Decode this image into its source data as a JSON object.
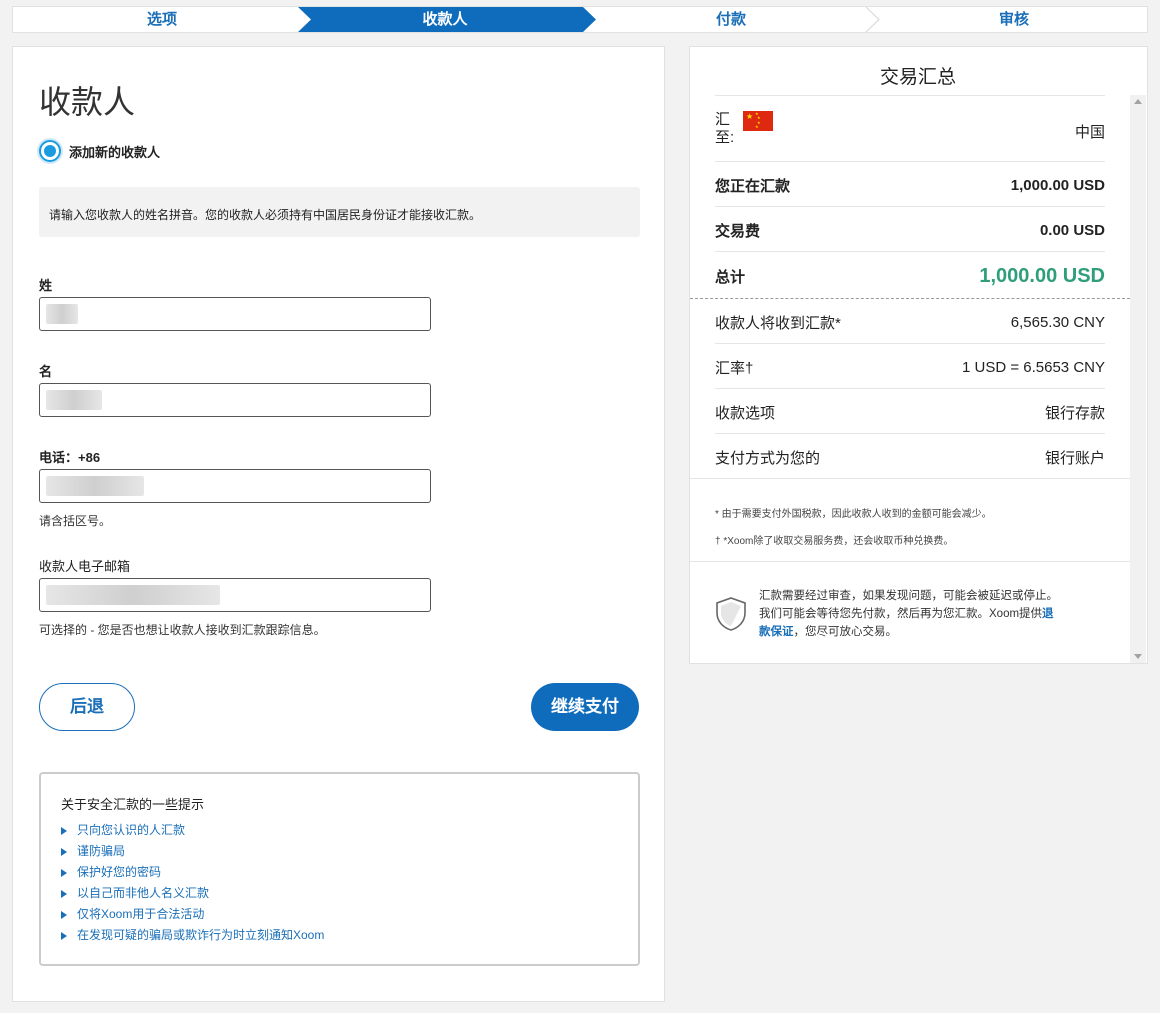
{
  "steps": [
    "选项",
    "收款人",
    "付款",
    "审核"
  ],
  "form": {
    "title": "收款人",
    "radio_label": "添加新的收款人",
    "info": "请输入您收款人的姓名拼音。您的收款人必须持有中国居民身份证才能接收汇款。",
    "surname_label": "姓",
    "given_label": "名",
    "phone_label": "电话：+86",
    "phone_hint": "请含括区号。",
    "email_label": "收款人电子邮箱",
    "email_hint": "可选择的 - 您是否也想让收款人接收到汇款跟踪信息。",
    "back": "后退",
    "continue": "继续支付"
  },
  "tips": {
    "title": "关于安全汇款的一些提示",
    "items": [
      "只向您认识的人汇款",
      "谨防骗局",
      "保护好您的密码",
      "以自己而非他人名义汇款",
      "仅将Xoom用于合法活动",
      "在发现可疑的骗局或欺诈行为时立刻通知Xoom"
    ]
  },
  "summary": {
    "title": "交易汇总",
    "to_label": "汇至:",
    "to_value": "中国",
    "sending_label": "您正在汇款",
    "sending_value": "1,000.00  USD",
    "fee_label": "交易费",
    "fee_value": "0.00  USD",
    "total_label": "总计",
    "total_value": "1,000.00  USD",
    "receive_label": "收款人将收到汇款*",
    "receive_value": "6,565.30  CNY",
    "rate_label": "汇率†",
    "rate_value": "1 USD = 6.5653 CNY",
    "option_label": "收款选项",
    "option_value": "银行存款",
    "pay_label": "支付方式为您的",
    "pay_value": "银行账户",
    "note1": "* 由于需要支付外国税款，因此收款人收到的金额可能会减少。",
    "note2": "† *Xoom除了收取交易服务费，还会收取币种兑换费。",
    "guarantee_pre": "汇款需要经过审查，如果发现问题，可能会被延迟或停止。我们可能会等待您先付款，然后再为您汇款。Xoom提供",
    "guarantee_link": "退款保证",
    "guarantee_post": "，您尽可放心交易。"
  },
  "colors": {
    "primary": "#0f6cbd",
    "total": "#2f9e7a",
    "step_active": "#0f6cbd"
  }
}
